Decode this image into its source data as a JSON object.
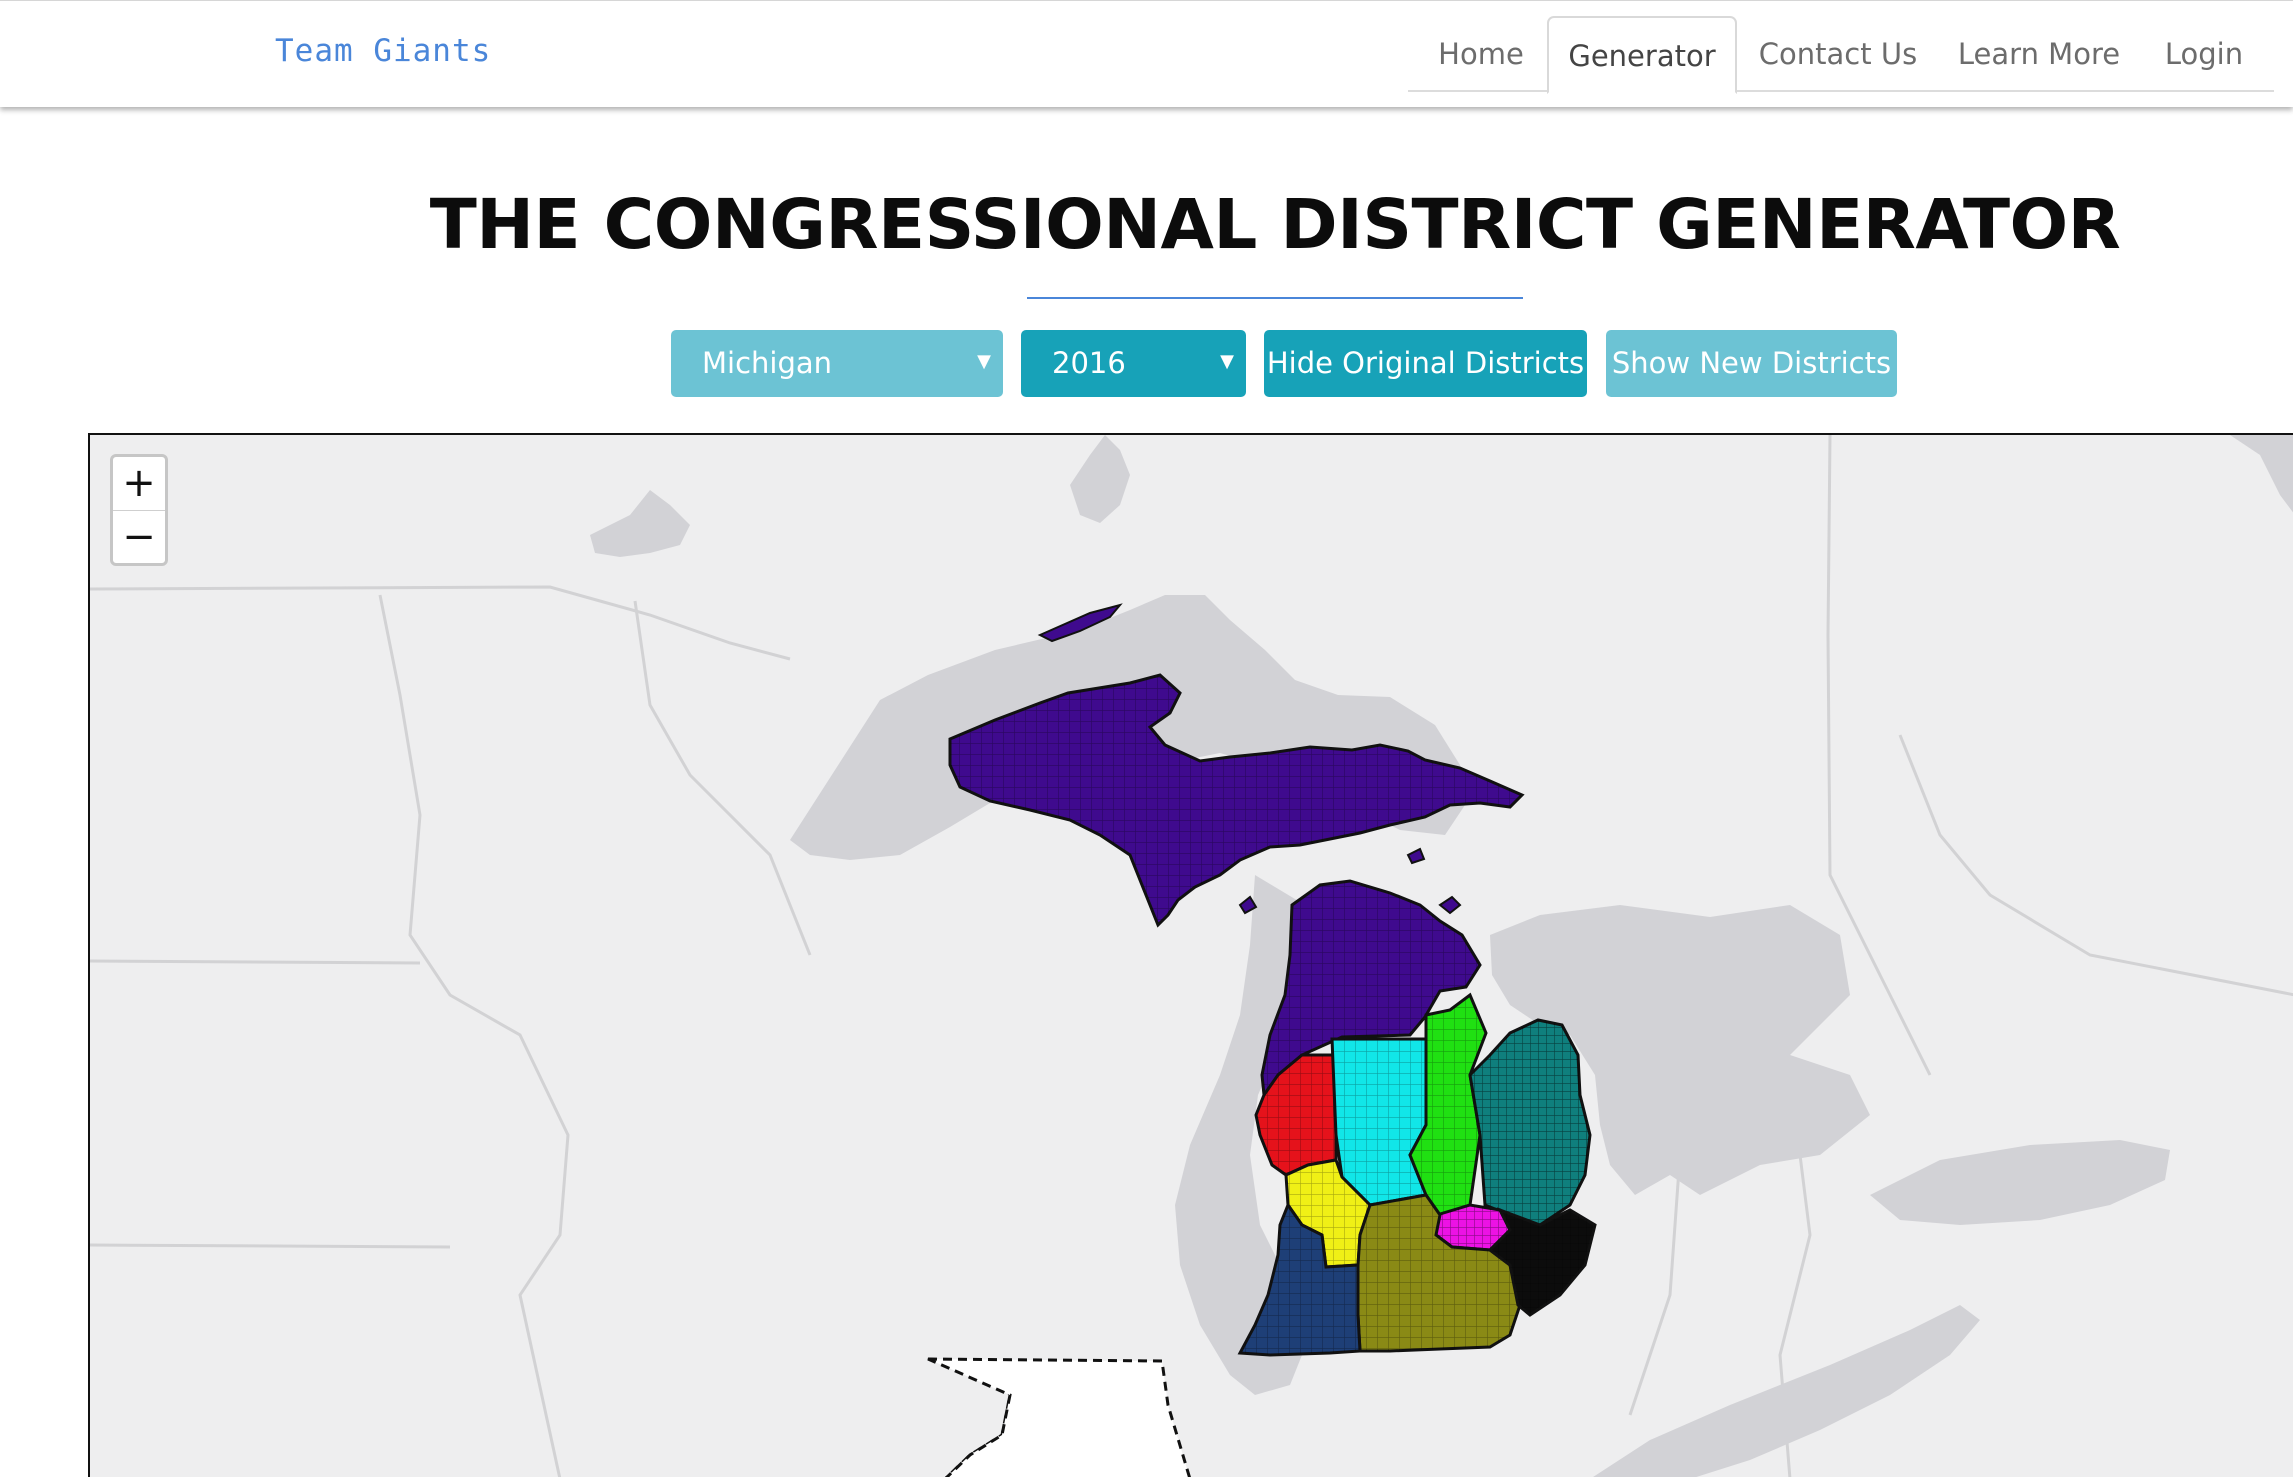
{
  "brand": "Team Giants",
  "nav": {
    "items": [
      {
        "label": "Home"
      },
      {
        "label": "Generator"
      },
      {
        "label": "Contact Us"
      },
      {
        "label": "Learn More"
      },
      {
        "label": "Login"
      }
    ],
    "active": "Generator"
  },
  "title": "THE CONGRESSIONAL DISTRICT GENERATOR",
  "controls": {
    "state_select": "Michigan",
    "year_select": "2016",
    "hide_original_label": "Hide Original Districts",
    "show_new_label": "Show New Districts"
  },
  "map": {
    "zoom_in": "+",
    "zoom_out": "−"
  },
  "colors": {
    "brand": "#4a86d9",
    "select_light": "#6cc3d4",
    "select_dark": "#17a2b8",
    "water": "#d2d2d6",
    "land": "#eeeeef",
    "district_purple": "#3f0a8e",
    "district_cyan": "#11e6e8",
    "district_green": "#20e012",
    "district_teal": "#0f7f7d",
    "district_red": "#e5121b",
    "district_yellow": "#f0f016",
    "district_magenta": "#ec12e4",
    "district_navy": "#1e3f77",
    "district_olive": "#8a8a15"
  }
}
